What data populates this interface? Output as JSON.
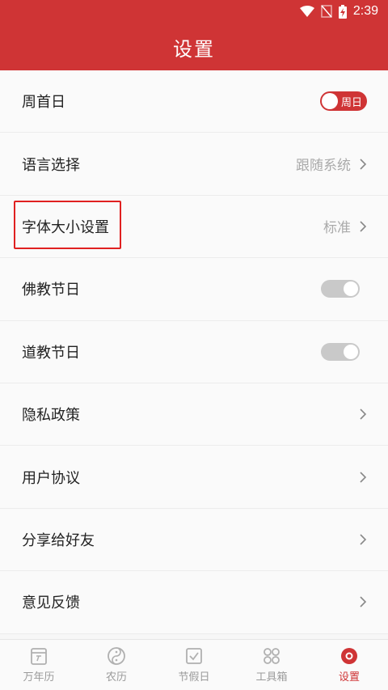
{
  "status_bar": {
    "time": "2:39"
  },
  "header": {
    "title": "设置"
  },
  "settings": {
    "week_start": {
      "label": "周首日",
      "toggle_label": "周日"
    },
    "language": {
      "label": "语言选择",
      "value": "跟随系统"
    },
    "font_size": {
      "label": "字体大小设置",
      "value": "标准"
    },
    "buddhist": {
      "label": "佛教节日"
    },
    "taoist": {
      "label": "道教节日"
    },
    "privacy": {
      "label": "隐私政策"
    },
    "agreement": {
      "label": "用户协议"
    },
    "share": {
      "label": "分享给好友"
    },
    "feedback": {
      "label": "意见反馈"
    }
  },
  "tabs": [
    {
      "label": "万年历",
      "icon": "calendar-icon"
    },
    {
      "label": "农历",
      "icon": "yin-yang-icon"
    },
    {
      "label": "节假日",
      "icon": "holiday-check-icon"
    },
    {
      "label": "工具箱",
      "icon": "toolbox-grid-icon"
    },
    {
      "label": "设置",
      "icon": "settings-flower-icon"
    }
  ],
  "colors": {
    "accent": "#cf3435",
    "muted": "#aaaaaa"
  }
}
